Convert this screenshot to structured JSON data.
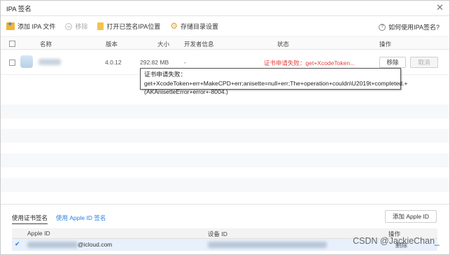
{
  "window": {
    "title": "IPA 签名"
  },
  "toolbar": {
    "add_ipa": "添加 IPA 文件",
    "remove": "移除",
    "open_location": "打开已签名IPA位置",
    "storage_settings": "存储目录设置",
    "help": "如何使用IPA签名?"
  },
  "table": {
    "headers": {
      "name": "名称",
      "version": "版本",
      "size": "大小",
      "developer": "开发者信息",
      "status": "状态",
      "action": "操作"
    },
    "rows": [
      {
        "version": "4.0.12",
        "size": "292.82 MB",
        "developer": "-",
        "status": "证书申请失败：get+XcodeToken...",
        "remove": "移除",
        "cancel": "取消"
      }
    ]
  },
  "tooltip": {
    "text": "证书申请失败：get+XcodeToken+err+MakeCPD+err;anisette=null+err;The+operation+couldn\\U2019t+completed.+(AKAnisetteError+error+-8004.)"
  },
  "cert_panel": {
    "tab_cert": "使用证书签名",
    "tab_apple_id": "使用 Apple ID 签名",
    "add_apple_id": "添加 Apple ID",
    "headers": {
      "apple_id": "Apple ID",
      "device_id": "设备 ID",
      "action": "操作"
    },
    "rows": [
      {
        "apple_id_suffix": "@icloud.com",
        "action": "删除"
      }
    ]
  },
  "watermark": "CSDN @JackieChan_"
}
